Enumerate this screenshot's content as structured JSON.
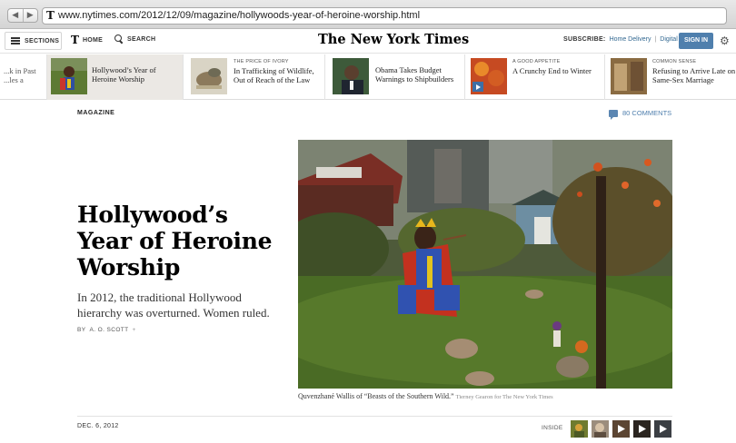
{
  "browser": {
    "back_glyph": "◀",
    "forward_glyph": "▶",
    "site_icon": "T",
    "url": "www.nytimes.com/2012/12/09/magazine/hollywoods-year-of-heroine-worship.html"
  },
  "masthead": {
    "sections_label": "SECTIONS",
    "home_logo": "T",
    "home_label": "HOME",
    "search_label": "SEARCH",
    "brand": "The New York Times",
    "subscribe_label": "SUBSCRIBE:",
    "home_delivery": "Home Delivery",
    "separator": "|",
    "digital": "Digital",
    "sign_in": "SIGN IN",
    "settings_glyph": "⚙"
  },
  "ribbon": [
    {
      "kicker": "",
      "title": "...k in Past\n...les a"
    },
    {
      "kicker": "",
      "title": "Hollywood’s Year of\nHeroine Worship"
    },
    {
      "kicker": "THE PRICE OF IVORY",
      "title": "In Trafficking of Wildlife,\nOut of Reach of the Law"
    },
    {
      "kicker": "",
      "title": "Obama Takes Budget\nWarnings to Shipbuilders"
    },
    {
      "kicker": "A GOOD APPETITE",
      "title": "A Crunchy End to Winter"
    },
    {
      "kicker": "COMMON SENSE",
      "title": "Refusing to Arrive Late on\nSame-Sex Marriage"
    }
  ],
  "article": {
    "section": "MAGAZINE",
    "comments": "80 COMMENTS",
    "headline": "Hollywood’s Year of Heroine Worship",
    "summary": "In 2012, the traditional Hollywood hierarchy was overturned. Women ruled.",
    "by": "BY",
    "author": "A. O. SCOTT",
    "author_plus": "+",
    "caption": "Quvenzhané Wallis of “Beasts of the Southern Wild.”",
    "credit": "Tierney Gearon for The New York Times",
    "date": "DEC. 6, 2012",
    "inside_label": "INSIDE"
  }
}
